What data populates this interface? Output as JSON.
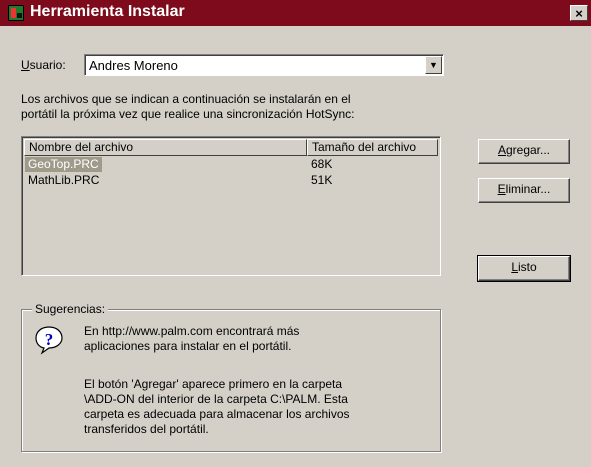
{
  "window": {
    "title": "Herramienta Instalar",
    "close_glyph": "×",
    "icon": "palm-app-icon"
  },
  "user": {
    "label_accel": "U",
    "label_rest": "suario:",
    "value": "Andres Moreno",
    "dropdown_glyph": "▼"
  },
  "description": {
    "line1": "Los archivos que se indican a continuación se instalarán en el",
    "line2": "portátil la próxima vez que realice una sincronización HotSync:"
  },
  "file_list": {
    "columns": [
      "Nombre del archivo",
      "Tamaño del archivo"
    ],
    "rows": [
      {
        "name": "GeoTop.PRC",
        "size": "68K",
        "selected": true
      },
      {
        "name": "MathLib.PRC",
        "size": "51K",
        "selected": false
      }
    ]
  },
  "buttons": {
    "add": {
      "accel": "A",
      "rest": "gregar..."
    },
    "remove": {
      "accel": "E",
      "rest": "liminar..."
    },
    "done": {
      "accel": "L",
      "rest": "isto"
    }
  },
  "tips": {
    "group_label": "Sugerencias:",
    "icon": "question-icon",
    "para1_line1": "En http://www.palm.com encontrará más",
    "para1_line2": "aplicaciones para instalar en el portátil.",
    "para2_line1": "El botón 'Agregar' aparece primero en la carpeta",
    "para2_line2": "\\ADD-ON del interior de la carpeta C:\\PALM. Esta",
    "para2_line3": "carpeta es adecuada para almacenar los archivos",
    "para2_line4": "transferidos del portátil."
  },
  "colors": {
    "titlebar": "#7e0b1b",
    "dialog_bg": "#d4d0c8",
    "selection": "#a09a8a"
  }
}
